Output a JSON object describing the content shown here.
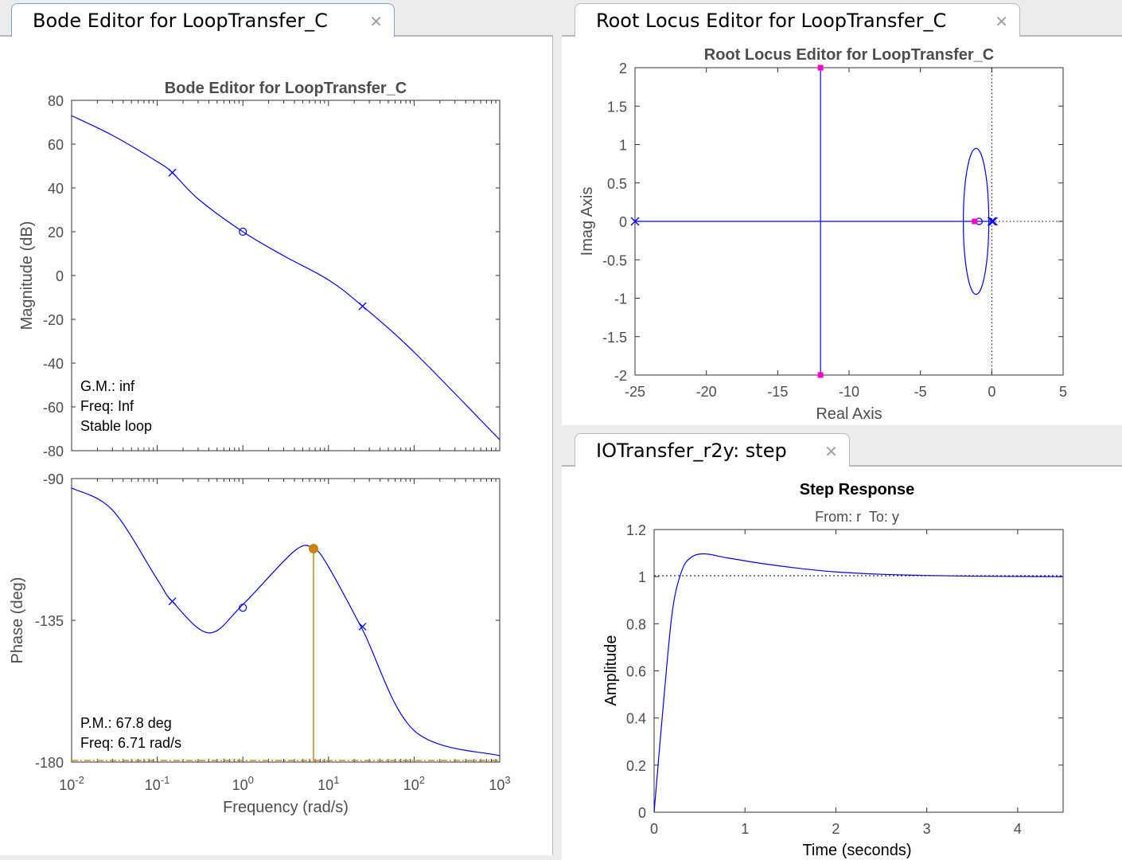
{
  "tabs": {
    "bode": {
      "label": "Bode Editor for LoopTransfer_C",
      "close_icon": "✕"
    },
    "rlocus": {
      "label": "Root Locus Editor for LoopTransfer_C",
      "close_icon": "✕"
    },
    "step": {
      "label": "IOTransfer_r2y: step",
      "close_icon": "✕"
    }
  },
  "bode": {
    "title": "Bode Editor for LoopTransfer_C",
    "mag_ylabel": "Magnitude (dB)",
    "phase_ylabel": "Phase (deg)",
    "xlabel": "Frequency (rad/s)",
    "mag_ticks": [
      "80",
      "60",
      "40",
      "20",
      "0",
      "-20",
      "-40",
      "-60",
      "-80"
    ],
    "phase_ticks": [
      "-90",
      "-135",
      "-180"
    ],
    "x_ticks": [
      {
        "base": "10",
        "exp": "-2"
      },
      {
        "base": "10",
        "exp": "-1"
      },
      {
        "base": "10",
        "exp": "0"
      },
      {
        "base": "10",
        "exp": "1"
      },
      {
        "base": "10",
        "exp": "2"
      },
      {
        "base": "10",
        "exp": "3"
      }
    ],
    "gm_text": "G.M.: inf",
    "gm_freq": "Freq: Inf",
    "stable_text": "Stable loop",
    "pm_text": "P.M.: 67.8 deg",
    "pm_freq": "Freq: 6.71 rad/s",
    "colors": {
      "curve": "#0000ff",
      "margin": "#d08a1a"
    }
  },
  "rlocus": {
    "title": "Root Locus Editor for LoopTransfer_C",
    "xlabel": "Real Axis",
    "ylabel": "Imag Axis",
    "x_ticks": [
      "-25",
      "-20",
      "-15",
      "-10",
      "-5",
      "0",
      "5"
    ],
    "y_ticks": [
      "2",
      "1.5",
      "1",
      "0.5",
      "0",
      "-0.5",
      "-1",
      "-1.5",
      "-2"
    ],
    "colors": {
      "locus": "#0000ff",
      "closed_loop_poles": "#ff00c8"
    }
  },
  "step": {
    "title": "Step Response",
    "subtitle": "From: r  To: y",
    "xlabel": "Time (seconds)",
    "ylabel": "Amplitude",
    "x_ticks": [
      "0",
      "1",
      "2",
      "3",
      "4"
    ],
    "y_ticks": [
      "1.2",
      "1",
      "0.8",
      "0.6",
      "0.4",
      "0.2",
      "0"
    ]
  },
  "chart_data": [
    {
      "type": "line",
      "title": "Bode Editor for LoopTransfer_C",
      "xlabel": "Frequency (rad/s)",
      "ylabel": "Magnitude (dB)",
      "xscale": "log",
      "xlim": [
        0.01,
        1000
      ],
      "ylim": [
        -80,
        80
      ],
      "x": [
        0.01,
        0.03,
        0.1,
        0.15,
        0.3,
        1,
        3,
        10,
        25,
        100,
        1000
      ],
      "y": [
        73,
        64,
        52,
        47,
        35,
        20,
        9,
        -2,
        -14,
        -35,
        -75
      ],
      "markers": [
        {
          "type": "pole",
          "x": 0.15,
          "y": 47
        },
        {
          "type": "zero",
          "x": 1,
          "y": 20
        },
        {
          "type": "pole",
          "x": 25,
          "y": -14
        }
      ]
    },
    {
      "type": "line",
      "xlabel": "Frequency (rad/s)",
      "ylabel": "Phase (deg)",
      "xscale": "log",
      "xlim": [
        0.01,
        1000
      ],
      "ylim": [
        -180,
        -90
      ],
      "x": [
        0.01,
        0.03,
        0.1,
        0.15,
        0.4,
        1,
        4,
        6.71,
        10,
        25,
        100,
        1000
      ],
      "y": [
        -93,
        -100,
        -122,
        -129,
        -139,
        -130,
        -113,
        -112.2,
        -118,
        -138,
        -170,
        -178
      ],
      "markers": [
        {
          "type": "pole",
          "x": 0.15,
          "y": -129
        },
        {
          "type": "zero",
          "x": 1,
          "y": -131
        },
        {
          "type": "pole",
          "x": 25,
          "y": -137
        }
      ],
      "phase_margin_point": {
        "x": 6.71,
        "y": -112.2
      }
    },
    {
      "type": "scatter",
      "title": "Root Locus Editor for LoopTransfer_C",
      "xlabel": "Real Axis",
      "ylabel": "Imag Axis",
      "xlim": [
        -25,
        5
      ],
      "ylim": [
        -2,
        2
      ],
      "poles": [
        [
          -25,
          0
        ],
        [
          0,
          0
        ],
        [
          0,
          0
        ]
      ],
      "zeros": [
        [
          -1,
          0
        ]
      ],
      "closed_loop_poles": [
        [
          -12,
          2
        ],
        [
          -12,
          -2
        ],
        [
          -1.2,
          0
        ]
      ]
    },
    {
      "type": "line",
      "title": "Step Response",
      "xlabel": "Time (seconds)",
      "ylabel": "Amplitude",
      "xlim": [
        0,
        4.5
      ],
      "ylim": [
        0,
        1.2
      ],
      "x": [
        0,
        0.1,
        0.2,
        0.3,
        0.4,
        0.55,
        0.8,
        1.2,
        1.6,
        2,
        2.5,
        3,
        3.5,
        4,
        4.5
      ],
      "y": [
        0,
        0.45,
        0.85,
        1.02,
        1.08,
        1.097,
        1.08,
        1.055,
        1.035,
        1.02,
        1.01,
        1.005,
        1.002,
        1.001,
        1.0
      ]
    }
  ]
}
